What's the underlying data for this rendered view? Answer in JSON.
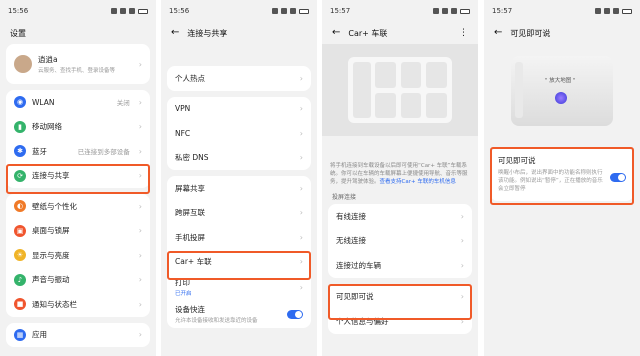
{
  "statusbar": {
    "s1": {
      "time": "15:56"
    },
    "s2": {
      "time": "15:56"
    },
    "s3": {
      "time": "15:57"
    },
    "s4": {
      "time": "15:57"
    }
  },
  "screen1": {
    "title": "设置",
    "account": {
      "name": "逍逍a",
      "desc": "云服务、查找手机、登录设备等"
    },
    "items": [
      {
        "label": "WLAN",
        "value": "关闭"
      },
      {
        "label": "移动网络",
        "value": ""
      },
      {
        "label": "蓝牙",
        "value": "已连接到多部设备"
      },
      {
        "label": "连接与共享",
        "value": ""
      },
      {
        "label": "壁纸与个性化",
        "value": ""
      },
      {
        "label": "桌面与锁屏",
        "value": ""
      },
      {
        "label": "显示与亮度",
        "value": ""
      },
      {
        "label": "声音与振动",
        "value": ""
      },
      {
        "label": "通知与状态栏",
        "value": ""
      },
      {
        "label": "应用",
        "value": ""
      }
    ]
  },
  "screen2": {
    "title": "连接与共享",
    "items": [
      {
        "label": "个人热点"
      },
      {
        "label": "VPN"
      },
      {
        "label": "NFC"
      },
      {
        "label": "私密 DNS"
      },
      {
        "label": "屏幕共享"
      },
      {
        "label": "跨屏互联"
      },
      {
        "label": "手机投屏"
      },
      {
        "label": "Car+ 车联"
      },
      {
        "label": "打印",
        "sub": "已开启"
      },
      {
        "label": "设备快连",
        "sub": "允许本设备接收和发送靠近的设备"
      }
    ]
  },
  "screen3": {
    "title": "Car+ 车联",
    "description": "将手机连接到车载设备以后即可使用“Car+ 车联”车载系统。你可以在车辆的车载屏幕上便捷使用导航、音乐等服务，提升驾驶体验。",
    "link": "查看支持Car+ 车联的车机信息",
    "section": "投屏连接",
    "items": [
      "有线连接",
      "无线连接",
      "连接过的车辆",
      "可见即可说",
      "个人信息与偏好"
    ]
  },
  "screen4": {
    "title": "可见即可说",
    "bubble": "\" 放大地图 \"",
    "setting": {
      "label": "可见即可说",
      "desc": "唤醒小布后，说出界面中的功能名称则执行该功能。例如说出“暂停”，正在播放的音乐会立即暂停"
    }
  },
  "colors": {
    "highlight": "#f05a28",
    "accent": "#2e6bf0"
  }
}
